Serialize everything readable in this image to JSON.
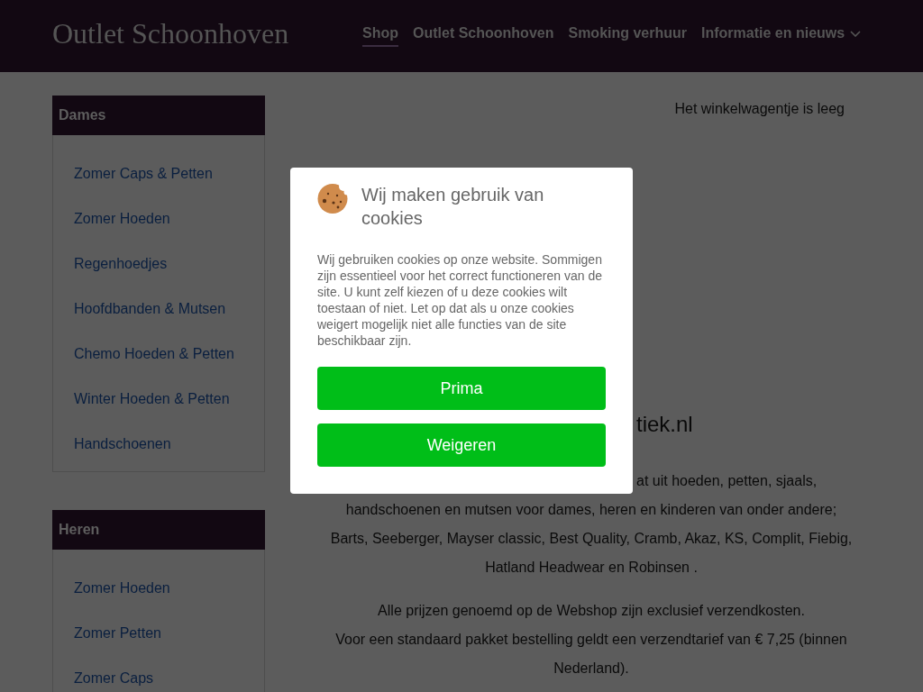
{
  "header": {
    "logo": "Outlet Schoonhoven",
    "nav": [
      {
        "label": "Shop",
        "selected": true,
        "has_dropdown": false
      },
      {
        "label": "Outlet Schoonhoven",
        "selected": false,
        "has_dropdown": false
      },
      {
        "label": "Smoking verhuur",
        "selected": false,
        "has_dropdown": false
      },
      {
        "label": "Informatie en nieuws",
        "selected": false,
        "has_dropdown": true
      }
    ]
  },
  "sidebar": {
    "categories": [
      {
        "title": "Dames",
        "items": [
          "Zomer Caps & Petten",
          "Zomer Hoeden",
          "Regenhoedjes",
          "Hoofdbanden & Mutsen",
          "Chemo Hoeden & Petten",
          "Winter Hoeden & Petten",
          "Handschoenen"
        ]
      },
      {
        "title": "Heren",
        "items": [
          "Zomer Hoeden",
          "Zomer Petten",
          "Zomer Caps"
        ]
      }
    ]
  },
  "cart": {
    "status": "Het winkelwagentje is leeg"
  },
  "content": {
    "heading": "tiek.nl",
    "paragraphs": [
      {
        "first_line_tail": "at uit hoeden, petten, sjaals,",
        "lines": [
          "handschoenen en mutsen voor dames, heren en kinderen van onder andere;",
          "Barts, Seeberger, Mayser classic, Best Quality, Cramb, Akaz, KS, Complit, Fiebig,",
          "Hatland Headwear en Robinsen ."
        ]
      },
      {
        "lines": [
          "Alle prijzen genoemd op de Webshop zijn exclusief verzendkosten.",
          "Voor een standaard pakket bestelling geldt een verzendtarief van € 7,25 (binnen",
          "Nederland)."
        ]
      }
    ]
  },
  "cookie_dialog": {
    "title": "Wij maken gebruik van cookies",
    "body": "Wij gebruiken cookies op onze website. Sommigen zijn essentieel voor het correct functioneren van de site. U kunt zelf kiezen of u deze cookies wilt toestaan of niet. Let op dat als u onze cookies weigert mogelijk niet alle functies van de site beschikbaar zijn.",
    "buttons": [
      "Prima",
      "Weigeren"
    ]
  }
}
